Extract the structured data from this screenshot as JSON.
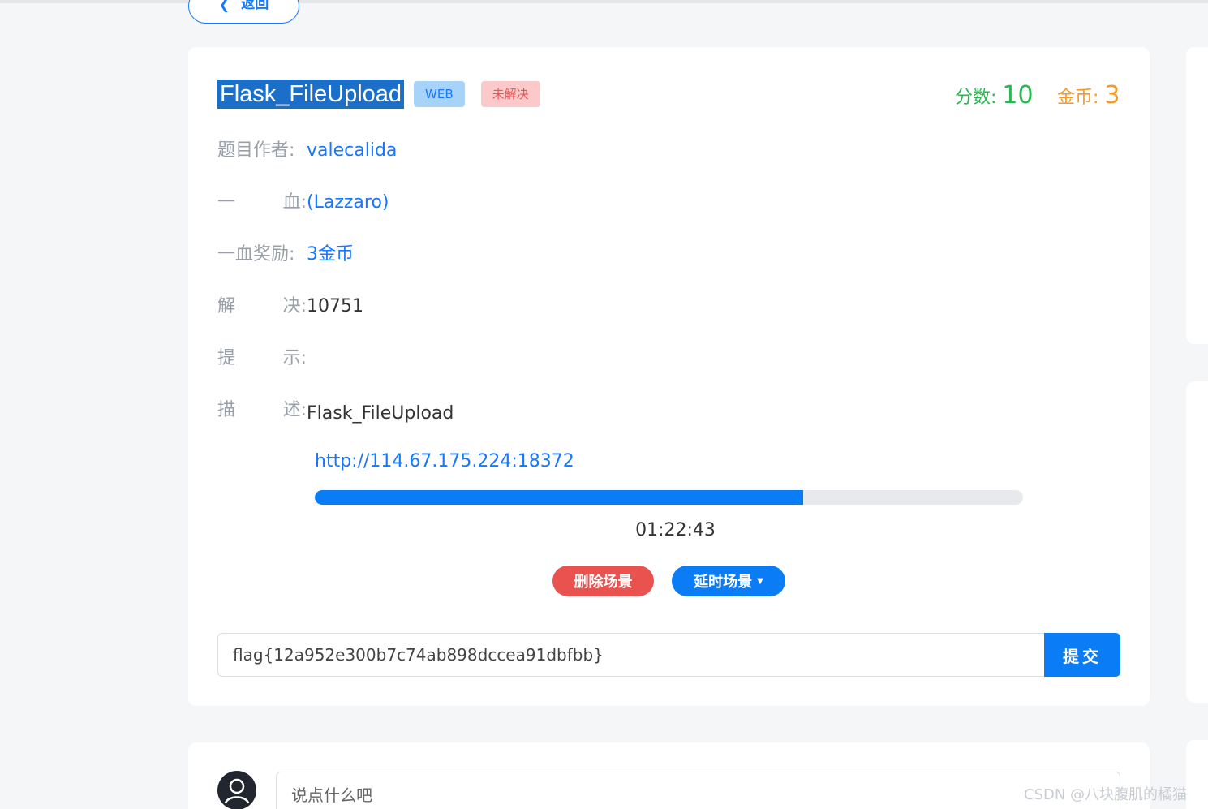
{
  "nav": {
    "back_label": "返回",
    "back_icon": "chevron-left-icon"
  },
  "challenge": {
    "title": "Flask_FileUpload",
    "category_tag": "WEB",
    "status_tag": "未解决",
    "score_label": "分数:",
    "score_value": "10",
    "coins_label": "金币:",
    "coins_value": "3",
    "author_label": "题目作者:",
    "author": "valecalida",
    "first_blood_label_1": "一",
    "first_blood_label_2": "血:",
    "first_blood": "(Lazzaro)",
    "first_blood_reward_label": "一血奖励:",
    "first_blood_reward": "3金币",
    "solves_label_1": "解",
    "solves_label_2": "决:",
    "solves": "10751",
    "hint_label_1": "提",
    "hint_label_2": "示:",
    "hint": "",
    "description_label_1": "描",
    "description_label_2": "述:",
    "description": "Flask_FileUpload"
  },
  "scene": {
    "url": "http://114.67.175.224:18372",
    "progress": 0.69,
    "timer": "01:22:43",
    "delete_label": "删除场景",
    "extend_label": "延时场景"
  },
  "submission": {
    "flag_value": "flag{12a952e300b7c74ab898dccea91dbfbb}",
    "submit_label": "提交"
  },
  "comments": {
    "placeholder": "说点什么吧"
  },
  "watermark": "CSDN @八块腹肌的橘猫",
  "colors": {
    "primary": "#0a7cf5",
    "danger": "#e9524f",
    "score": "#26b94f",
    "coins": "#f39a2a"
  }
}
